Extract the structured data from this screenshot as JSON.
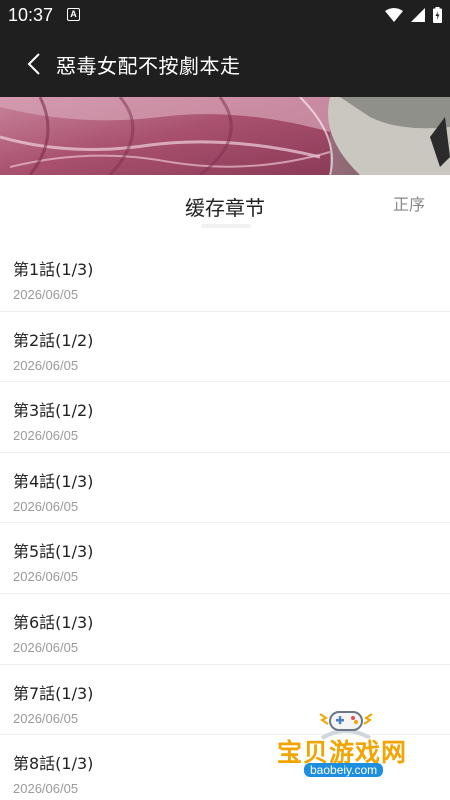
{
  "status_bar": {
    "time": "10:37",
    "notification_glyph": "A",
    "icons": [
      "wifi-icon",
      "signal-icon",
      "battery-icon"
    ]
  },
  "toolbar": {
    "title": "惡毒女配不按劇本走",
    "back_icon": "chevron-left-icon"
  },
  "sheet": {
    "title": "缓存章节",
    "sort_label": "正序"
  },
  "chapters": [
    {
      "name": "第1話(1/3)",
      "date": "2026/06/05"
    },
    {
      "name": "第2話(1/2)",
      "date": "2026/06/05"
    },
    {
      "name": "第3話(1/2)",
      "date": "2026/06/05"
    },
    {
      "name": "第4話(1/3)",
      "date": "2026/06/05"
    },
    {
      "name": "第5話(1/3)",
      "date": "2026/06/05"
    },
    {
      "name": "第6話(1/3)",
      "date": "2026/06/05"
    },
    {
      "name": "第7話(1/3)",
      "date": "2026/06/05"
    },
    {
      "name": "第8話(1/3)",
      "date": "2026/06/05"
    }
  ],
  "watermark": {
    "text": "宝贝游戏网",
    "url": "baobeiy.com"
  },
  "colors": {
    "toolbar_bg": "#1f1f1f",
    "watermark_orange": "#f2a400",
    "watermark_blue": "#1c8fe0"
  }
}
